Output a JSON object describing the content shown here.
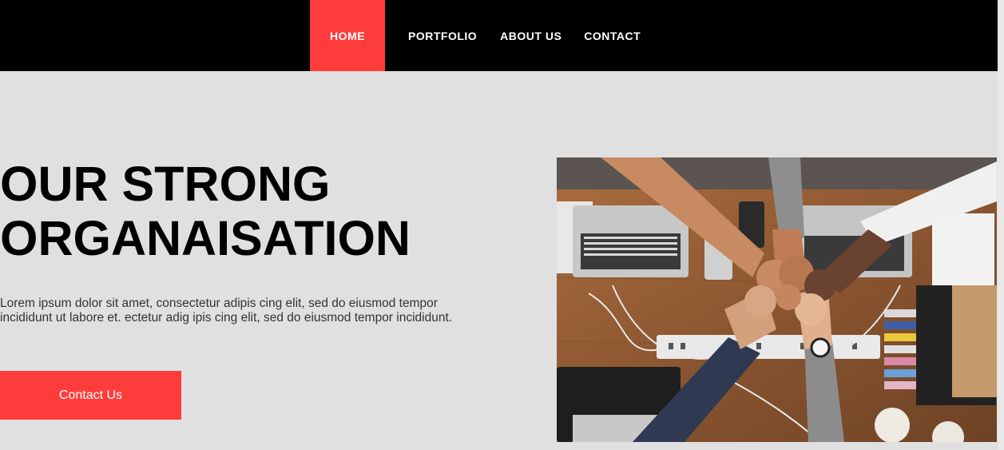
{
  "nav": {
    "items": [
      {
        "label": "HOME",
        "active": true
      },
      {
        "label": "PORTFOLIO",
        "active": false
      },
      {
        "label": "ABOUT US",
        "active": false
      },
      {
        "label": "CONTACT",
        "active": false
      }
    ]
  },
  "hero": {
    "title_line1": "OUR STRONG",
    "title_line2": "ORGANAISATION",
    "text_line1": "Lorem ipsum dolor sit amet, consectetur adipis cing elit, sed do eiusmod tempor",
    "text_line2": "incididunt ut labore et. ectetur adig ipis cing elit, sed do eiusmod tempor incididunt.",
    "cta_label": "Contact Us",
    "image_subject": "team-fist-bump-photo"
  },
  "colors": {
    "nav_bg": "#000000",
    "accent": "#ff3c3c",
    "page_bg": "#e0e0e0",
    "text_dark": "#000000",
    "text_body": "#333333"
  }
}
